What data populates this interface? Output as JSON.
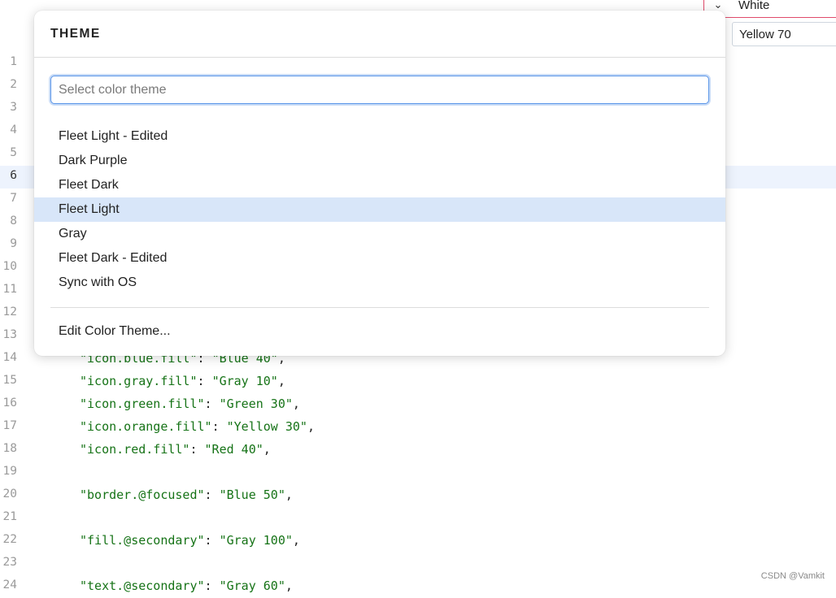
{
  "editor": {
    "current_line": 6,
    "lines": [
      {
        "n": "1",
        "key": "",
        "val": ""
      },
      {
        "n": "2",
        "key": "",
        "val": ""
      },
      {
        "n": "3",
        "key": "",
        "val": ""
      },
      {
        "n": "4",
        "key": "",
        "val": ""
      },
      {
        "n": "5",
        "key": "",
        "val": ""
      },
      {
        "n": "6",
        "key": "",
        "val": ""
      },
      {
        "n": "7",
        "key": "",
        "val": ""
      },
      {
        "n": "8",
        "key": "",
        "val": ""
      },
      {
        "n": "9",
        "key": "",
        "val": ""
      },
      {
        "n": "10",
        "key": "",
        "val": ""
      },
      {
        "n": "11",
        "key": "",
        "val": ""
      },
      {
        "n": "12",
        "key": "",
        "val": ""
      },
      {
        "n": "13",
        "key": "",
        "val": ""
      },
      {
        "n": "14",
        "key": "\"icon.blue.fill\"",
        "val": "\"Blue 40\""
      },
      {
        "n": "15",
        "key": "\"icon.gray.fill\"",
        "val": "\"Gray 10\""
      },
      {
        "n": "16",
        "key": "\"icon.green.fill\"",
        "val": "\"Green 30\""
      },
      {
        "n": "17",
        "key": "\"icon.orange.fill\"",
        "val": "\"Yellow 30\""
      },
      {
        "n": "18",
        "key": "\"icon.red.fill\"",
        "val": "\"Red 40\""
      },
      {
        "n": "19",
        "key": "",
        "val": ""
      },
      {
        "n": "20",
        "key": "\"border.@focused\"",
        "val": "\"Blue 50\""
      },
      {
        "n": "21",
        "key": "",
        "val": ""
      },
      {
        "n": "22",
        "key": "\"fill.@secondary\"",
        "val": "\"Gray 100\""
      },
      {
        "n": "23",
        "key": "",
        "val": ""
      },
      {
        "n": "24",
        "key": "\"text.@secondary\"",
        "val": "\"Gray 60\""
      }
    ]
  },
  "top_right": {
    "chevron": "⌄",
    "value_white": "White",
    "value_yellow": "Yellow 70"
  },
  "popup": {
    "title": "THEME",
    "search_placeholder": "Select color theme",
    "options": [
      {
        "label": "Fleet Light - Edited",
        "selected": false
      },
      {
        "label": "Dark Purple",
        "selected": false
      },
      {
        "label": "Fleet Dark",
        "selected": false
      },
      {
        "label": "Fleet Light",
        "selected": true
      },
      {
        "label": "Gray",
        "selected": false
      },
      {
        "label": "Fleet Dark - Edited",
        "selected": false
      },
      {
        "label": "Sync with OS",
        "selected": false
      }
    ],
    "edit_label": "Edit Color Theme..."
  },
  "watermark": "CSDN @Vamkit",
  "colors": {
    "accent": "#5a95e8",
    "selected_bg": "#d8e6f9",
    "current_line_bg": "#edf3fd",
    "string_green": "#167317",
    "error_border": "#e04b6b"
  }
}
